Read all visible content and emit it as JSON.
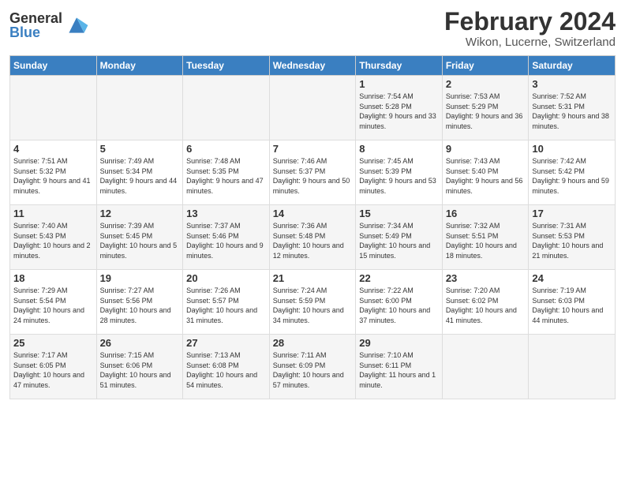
{
  "header": {
    "logo_general": "General",
    "logo_blue": "Blue",
    "month_title": "February 2024",
    "location": "Wikon, Lucerne, Switzerland"
  },
  "days_of_week": [
    "Sunday",
    "Monday",
    "Tuesday",
    "Wednesday",
    "Thursday",
    "Friday",
    "Saturday"
  ],
  "weeks": [
    [
      {
        "day": "",
        "info": ""
      },
      {
        "day": "",
        "info": ""
      },
      {
        "day": "",
        "info": ""
      },
      {
        "day": "",
        "info": ""
      },
      {
        "day": "1",
        "info": "Sunrise: 7:54 AM\nSunset: 5:28 PM\nDaylight: 9 hours\nand 33 minutes."
      },
      {
        "day": "2",
        "info": "Sunrise: 7:53 AM\nSunset: 5:29 PM\nDaylight: 9 hours\nand 36 minutes."
      },
      {
        "day": "3",
        "info": "Sunrise: 7:52 AM\nSunset: 5:31 PM\nDaylight: 9 hours\nand 38 minutes."
      }
    ],
    [
      {
        "day": "4",
        "info": "Sunrise: 7:51 AM\nSunset: 5:32 PM\nDaylight: 9 hours\nand 41 minutes."
      },
      {
        "day": "5",
        "info": "Sunrise: 7:49 AM\nSunset: 5:34 PM\nDaylight: 9 hours\nand 44 minutes."
      },
      {
        "day": "6",
        "info": "Sunrise: 7:48 AM\nSunset: 5:35 PM\nDaylight: 9 hours\nand 47 minutes."
      },
      {
        "day": "7",
        "info": "Sunrise: 7:46 AM\nSunset: 5:37 PM\nDaylight: 9 hours\nand 50 minutes."
      },
      {
        "day": "8",
        "info": "Sunrise: 7:45 AM\nSunset: 5:39 PM\nDaylight: 9 hours\nand 53 minutes."
      },
      {
        "day": "9",
        "info": "Sunrise: 7:43 AM\nSunset: 5:40 PM\nDaylight: 9 hours\nand 56 minutes."
      },
      {
        "day": "10",
        "info": "Sunrise: 7:42 AM\nSunset: 5:42 PM\nDaylight: 9 hours\nand 59 minutes."
      }
    ],
    [
      {
        "day": "11",
        "info": "Sunrise: 7:40 AM\nSunset: 5:43 PM\nDaylight: 10 hours\nand 2 minutes."
      },
      {
        "day": "12",
        "info": "Sunrise: 7:39 AM\nSunset: 5:45 PM\nDaylight: 10 hours\nand 5 minutes."
      },
      {
        "day": "13",
        "info": "Sunrise: 7:37 AM\nSunset: 5:46 PM\nDaylight: 10 hours\nand 9 minutes."
      },
      {
        "day": "14",
        "info": "Sunrise: 7:36 AM\nSunset: 5:48 PM\nDaylight: 10 hours\nand 12 minutes."
      },
      {
        "day": "15",
        "info": "Sunrise: 7:34 AM\nSunset: 5:49 PM\nDaylight: 10 hours\nand 15 minutes."
      },
      {
        "day": "16",
        "info": "Sunrise: 7:32 AM\nSunset: 5:51 PM\nDaylight: 10 hours\nand 18 minutes."
      },
      {
        "day": "17",
        "info": "Sunrise: 7:31 AM\nSunset: 5:53 PM\nDaylight: 10 hours\nand 21 minutes."
      }
    ],
    [
      {
        "day": "18",
        "info": "Sunrise: 7:29 AM\nSunset: 5:54 PM\nDaylight: 10 hours\nand 24 minutes."
      },
      {
        "day": "19",
        "info": "Sunrise: 7:27 AM\nSunset: 5:56 PM\nDaylight: 10 hours\nand 28 minutes."
      },
      {
        "day": "20",
        "info": "Sunrise: 7:26 AM\nSunset: 5:57 PM\nDaylight: 10 hours\nand 31 minutes."
      },
      {
        "day": "21",
        "info": "Sunrise: 7:24 AM\nSunset: 5:59 PM\nDaylight: 10 hours\nand 34 minutes."
      },
      {
        "day": "22",
        "info": "Sunrise: 7:22 AM\nSunset: 6:00 PM\nDaylight: 10 hours\nand 37 minutes."
      },
      {
        "day": "23",
        "info": "Sunrise: 7:20 AM\nSunset: 6:02 PM\nDaylight: 10 hours\nand 41 minutes."
      },
      {
        "day": "24",
        "info": "Sunrise: 7:19 AM\nSunset: 6:03 PM\nDaylight: 10 hours\nand 44 minutes."
      }
    ],
    [
      {
        "day": "25",
        "info": "Sunrise: 7:17 AM\nSunset: 6:05 PM\nDaylight: 10 hours\nand 47 minutes."
      },
      {
        "day": "26",
        "info": "Sunrise: 7:15 AM\nSunset: 6:06 PM\nDaylight: 10 hours\nand 51 minutes."
      },
      {
        "day": "27",
        "info": "Sunrise: 7:13 AM\nSunset: 6:08 PM\nDaylight: 10 hours\nand 54 minutes."
      },
      {
        "day": "28",
        "info": "Sunrise: 7:11 AM\nSunset: 6:09 PM\nDaylight: 10 hours\nand 57 minutes."
      },
      {
        "day": "29",
        "info": "Sunrise: 7:10 AM\nSunset: 6:11 PM\nDaylight: 11 hours\nand 1 minute."
      },
      {
        "day": "",
        "info": ""
      },
      {
        "day": "",
        "info": ""
      }
    ]
  ]
}
